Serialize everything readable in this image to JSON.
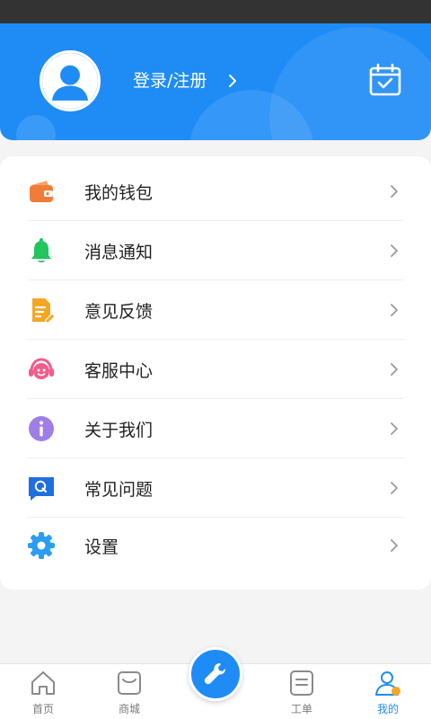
{
  "header": {
    "login_label": "登录/注册",
    "background_color": "#1f8cf6"
  },
  "menu": {
    "items": [
      {
        "key": "wallet",
        "label": "我的钱包",
        "icon": "wallet-icon",
        "color": "#f07c3a"
      },
      {
        "key": "notifications",
        "label": "消息通知",
        "icon": "bell-icon",
        "color": "#22c55e"
      },
      {
        "key": "feedback",
        "label": "意见反馈",
        "icon": "feedback-icon",
        "color": "#f5a623"
      },
      {
        "key": "customer-service",
        "label": "客服中心",
        "icon": "headset-icon",
        "color": "#f25c8b"
      },
      {
        "key": "about",
        "label": "关于我们",
        "icon": "info-icon",
        "color": "#a07ee8"
      },
      {
        "key": "faq",
        "label": "常见问题",
        "icon": "faq-chat-icon",
        "color": "#1f6fe0"
      },
      {
        "key": "settings",
        "label": "设置",
        "icon": "gear-icon",
        "color": "#2a9df4"
      }
    ]
  },
  "tabbar": {
    "tabs": [
      {
        "key": "home",
        "label": "首页",
        "icon": "home-icon"
      },
      {
        "key": "mall",
        "label": "商城",
        "icon": "shop-icon"
      },
      {
        "key": "workorder",
        "label": "工单",
        "icon": "list-icon"
      },
      {
        "key": "mine",
        "label": "我的",
        "icon": "user-icon",
        "active": true
      }
    ],
    "center_icon": "wrench-icon",
    "active_color": "#1f8cf6"
  }
}
